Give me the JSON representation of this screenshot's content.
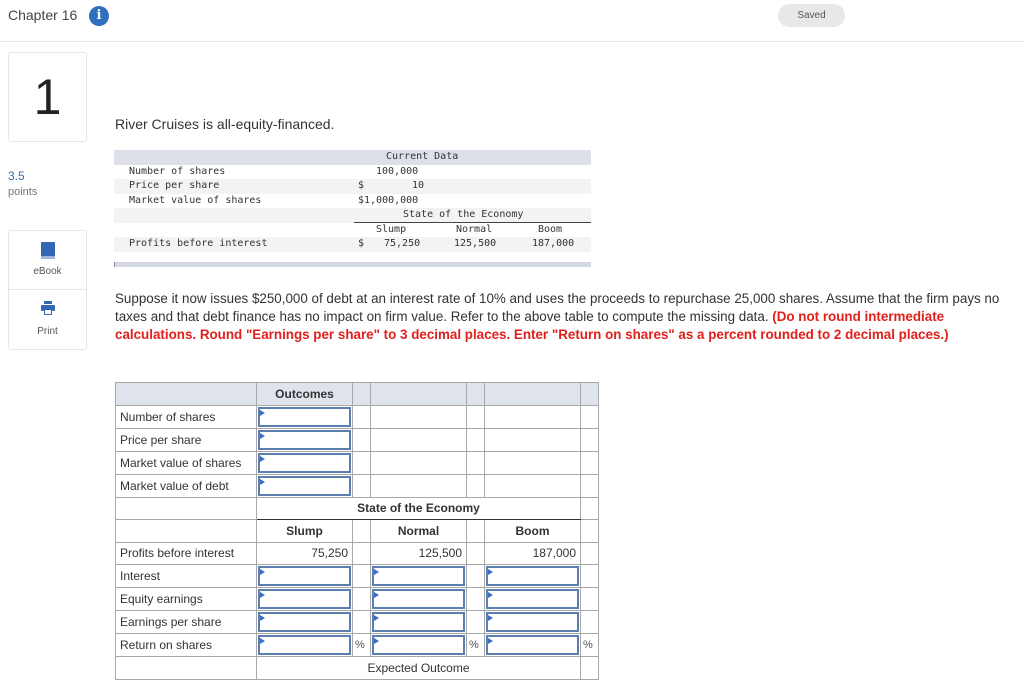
{
  "header": {
    "chapter": "Chapter 16",
    "info_icon": "info-icon",
    "status": "Saved"
  },
  "sidebar": {
    "question_number": "1",
    "points_value": "3.5",
    "points_label": "points",
    "tools": [
      {
        "label": "eBook",
        "icon": "book-icon"
      },
      {
        "label": "Print",
        "icon": "printer-icon"
      }
    ]
  },
  "question": {
    "intro": "River Cruises is all-equity-financed.",
    "data_table": {
      "header": "Current Data",
      "rows": [
        {
          "label": "Number of shares",
          "currency": "",
          "value": "100,000"
        },
        {
          "label": "Price per share",
          "currency": "$",
          "value": "10"
        },
        {
          "label": "Market value of shares",
          "currency": "",
          "value": "$1,000,000"
        }
      ],
      "economy_header": "State of the Economy",
      "states": [
        "Slump",
        "Normal",
        "Boom"
      ],
      "profits_label": "Profits before interest",
      "profits_currency": "$",
      "profits": [
        "75,250",
        "125,500",
        "187,000"
      ]
    },
    "paragraph_normal": "Suppose it now issues $250,000 of debt at an interest rate of 10% and uses the proceeds to repurchase 25,000 shares. Assume that the firm pays no taxes and that debt finance has no impact on firm value. Refer to the above table to compute the missing data. ",
    "paragraph_red": "(Do not round intermediate calculations. Round \"Earnings per share\" to 3 decimal places. Enter \"Return on shares\" as a percent rounded to 2 decimal places.)"
  },
  "answer_table": {
    "outcomes_header": "Outcomes",
    "outcome_rows": [
      {
        "label": "Number of shares",
        "value": ""
      },
      {
        "label": "Price per share",
        "value": ""
      },
      {
        "label": "Market value of shares",
        "value": ""
      },
      {
        "label": "Market value of debt",
        "value": ""
      }
    ],
    "economy_header": "State of the Economy",
    "states": [
      "Slump",
      "Normal",
      "Boom"
    ],
    "profits_label": "Profits before interest",
    "profits": [
      "75,250",
      "125,500",
      "187,000"
    ],
    "input_rows": [
      {
        "label": "Interest",
        "values": [
          "",
          "",
          ""
        ],
        "suffix": ""
      },
      {
        "label": "Equity earnings",
        "values": [
          "",
          "",
          ""
        ],
        "suffix": ""
      },
      {
        "label": "Earnings per share",
        "values": [
          "",
          "",
          ""
        ],
        "suffix": ""
      },
      {
        "label": "Return on shares",
        "values": [
          "",
          "",
          ""
        ],
        "suffix": "%"
      }
    ],
    "footer": "Expected Outcome"
  },
  "colors": {
    "accent": "#2f6fc0",
    "instruction_red": "#e0201c",
    "input_border": "#5b7fae",
    "header_bg": "#dfe3ec"
  }
}
